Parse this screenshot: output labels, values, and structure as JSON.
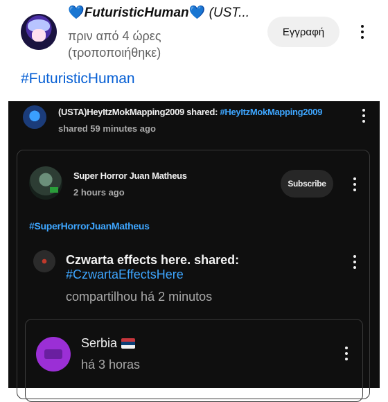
{
  "post": {
    "channel_name": "FuturisticHuman",
    "channel_heart": "💙",
    "channel_suffix": "(UST...",
    "time": "πριν από 4 ώρες",
    "edited": "(τροποποιήθηκε)",
    "subscribe_label": "Εγγραφή",
    "hashtag": "#FuturisticHuman"
  },
  "shared_post": {
    "author": "(USTA)HeyItzMokMapping2009",
    "shared_word": "shared:",
    "hashtag": "#HeyItzMokMapping2009",
    "time": "shared 59 minutes ago"
  },
  "inner_post": {
    "channel_name": "Super Horror Juan Matheus",
    "time": "2 hours ago",
    "subscribe_label": "Subscribe",
    "hashtag": "#SuperHorrorJuanMatheus"
  },
  "inner_share": {
    "author_line": "Czwarta effects here. shared:",
    "hashtag": "#CzwartaEffectsHere",
    "time": "compartilhou há 2 minutos"
  },
  "nested_post": {
    "channel_name": "Serbia",
    "flag": "serbia-flag-icon",
    "time": "há 3 horas"
  },
  "colors": {
    "link_light": "#065fd4",
    "link_dark": "#3ea6ff",
    "dark_bg": "#0f0f0f"
  }
}
